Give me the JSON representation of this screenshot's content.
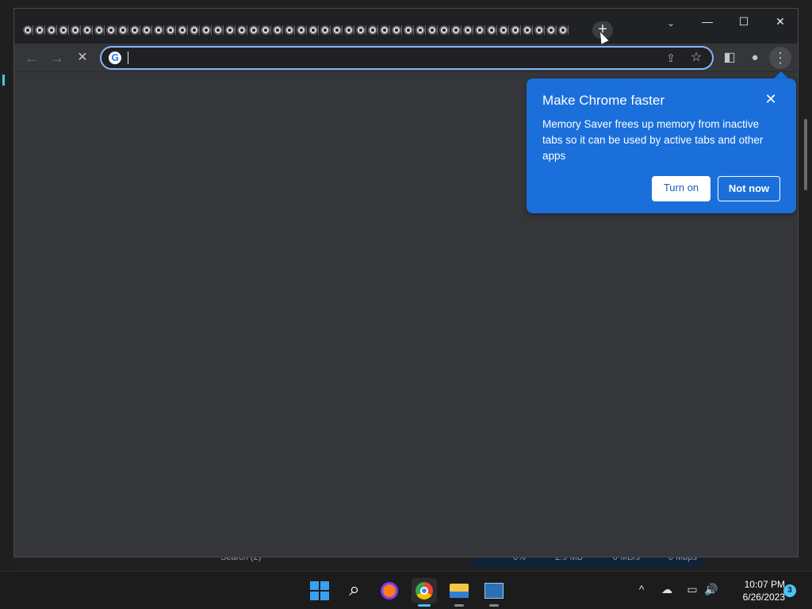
{
  "background_app": {
    "search_label": "Search (2)",
    "stats": [
      "0%",
      "2.9 MB",
      "0 MB/s",
      "0 Mbps"
    ]
  },
  "browser": {
    "tab_count": 46,
    "new_tab_symbol": "+",
    "tab_search_symbol": "⌄",
    "window_controls": {
      "minimize": "—",
      "maximize": "☐",
      "close": "✕"
    },
    "toolbar": {
      "back": "←",
      "forward": "→",
      "stop": "✕",
      "side_panel": "◧",
      "profile": "●",
      "menu": "⋮"
    },
    "omnibox": {
      "value": "",
      "placeholder": "",
      "google_glyph": "G",
      "share_glyph": "⇪",
      "star_glyph": "☆"
    }
  },
  "bubble": {
    "title": "Make Chrome faster",
    "body": "Memory Saver frees up memory from inactive tabs so it can be used by active tabs and other apps",
    "close": "✕",
    "turn_on": "Turn on",
    "not_now": "Not now",
    "color": "#1a6fdb"
  },
  "taskbar": {
    "search_glyph": "⌕",
    "tray": {
      "chevron": "^",
      "onedrive": "☁",
      "network": "▭",
      "volume": "🔊"
    },
    "time": "10:07 PM",
    "date": "6/26/2023",
    "notifications": "3",
    "accent": "#4cc2ff"
  }
}
